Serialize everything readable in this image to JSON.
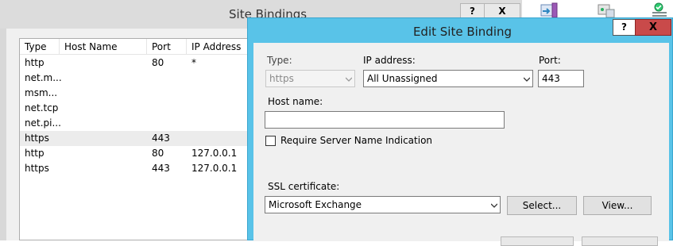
{
  "background": {
    "site_bindings": {
      "title": "Site Bindings",
      "help_label": "?",
      "close_label": "X",
      "columns": [
        "Type",
        "Host Name",
        "Port",
        "IP Address"
      ],
      "rows": [
        {
          "type": "http",
          "host": "",
          "port": "80",
          "ip": "*"
        },
        {
          "type": "net.m...",
          "host": "",
          "port": "",
          "ip": ""
        },
        {
          "type": "msm...",
          "host": "",
          "port": "",
          "ip": ""
        },
        {
          "type": "net.tcp",
          "host": "",
          "port": "",
          "ip": ""
        },
        {
          "type": "net.pi...",
          "host": "",
          "port": "",
          "ip": ""
        },
        {
          "type": "https",
          "host": "",
          "port": "443",
          "ip": ""
        },
        {
          "type": "http",
          "host": "",
          "port": "80",
          "ip": "127.0.0.1"
        },
        {
          "type": "https",
          "host": "",
          "port": "443",
          "ip": "127.0.0.1"
        }
      ],
      "selected_row": 5
    }
  },
  "edit_dialog": {
    "title": "Edit Site Binding",
    "help_label": "?",
    "close_label": "X",
    "type_label": "Type:",
    "type_value": "https",
    "ip_label": "IP address:",
    "ip_value": "All Unassigned",
    "port_label": "Port:",
    "port_value": "443",
    "hostname_label": "Host name:",
    "hostname_value": "",
    "sni_label": "Require Server Name Indication",
    "sni_checked": false,
    "ssl_label": "SSL certificate:",
    "ssl_value": "Microsoft Exchange",
    "select_label": "Select...",
    "view_label": "View..."
  },
  "colors": {
    "dialog_frame": "#59c3e8",
    "close_button": "#c94a4a",
    "dialog_body": "#f0f0f0"
  }
}
